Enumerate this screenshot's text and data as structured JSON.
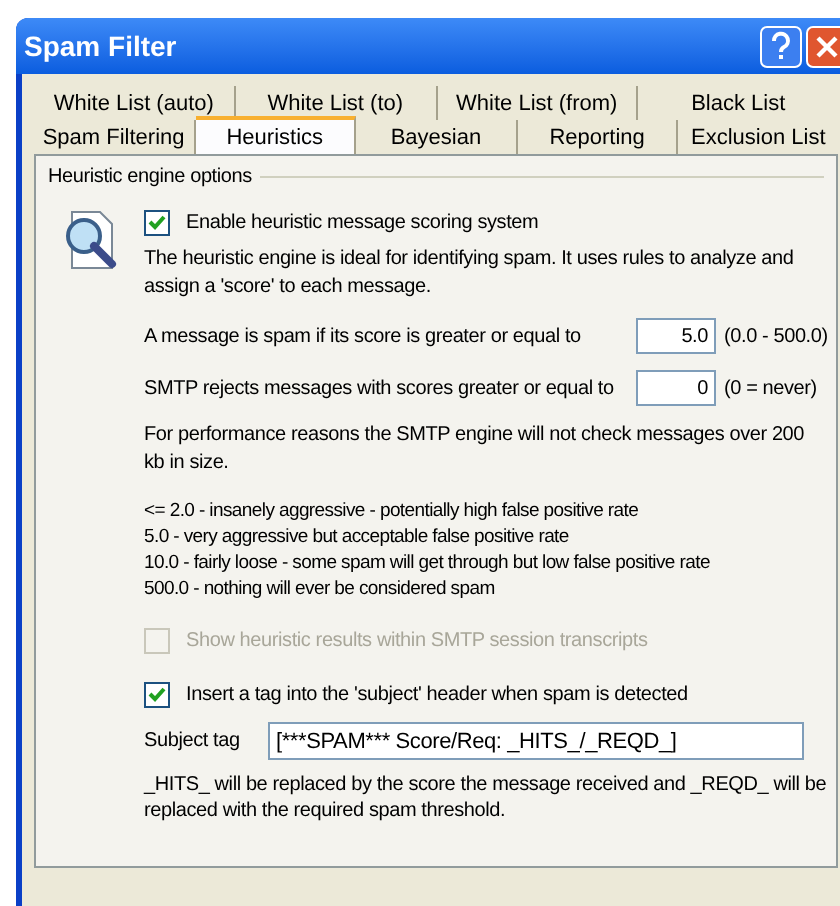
{
  "window": {
    "title": "Spam Filter"
  },
  "tab_rows": [
    [
      {
        "label": "White List (auto)",
        "selected": false
      },
      {
        "label": "White List (to)",
        "selected": false
      },
      {
        "label": "White List (from)",
        "selected": false
      },
      {
        "label": "Black List",
        "selected": false
      }
    ],
    [
      {
        "label": "Spam Filtering",
        "selected": false
      },
      {
        "label": "Heuristics",
        "selected": true
      },
      {
        "label": "Bayesian",
        "selected": false
      },
      {
        "label": "Reporting",
        "selected": false
      },
      {
        "label": "Exclusion List",
        "selected": false
      }
    ]
  ],
  "group": {
    "title": "Heuristic engine options",
    "enable": {
      "label": "Enable heuristic message scoring system",
      "checked": true
    },
    "intro": "The heuristic engine is ideal for identifying spam.  It uses rules to analyze and assign a 'score' to each message.",
    "fields": [
      {
        "label": "A message is spam if its score is greater or equal to",
        "value": "5.0",
        "hint": "(0.0 - 500.0)"
      },
      {
        "label": "SMTP rejects messages with scores greater or equal to",
        "value": "0",
        "hint": "(0 = never)"
      }
    ],
    "performance_note": "For performance reasons the SMTP engine will not check messages over 200 kb in size.",
    "scale": [
      "<= 2.0 - insanely aggressive - potentially high false positive rate",
      "5.0 - very aggressive but acceptable false positive rate",
      "10.0 - fairly loose - some spam will get through but low false positive rate",
      "500.0 - nothing will ever be considered spam"
    ],
    "show_results": {
      "label": "Show heuristic results within SMTP session transcripts",
      "checked": false,
      "disabled": true
    },
    "insert_tag": {
      "label": "Insert a tag into the 'subject' header when spam is detected",
      "checked": true
    },
    "subject_tag": {
      "label": "Subject tag",
      "value": "[***SPAM*** Score/Req: _HITS_/_REQD_]"
    },
    "tag_note": "_HITS_ will be replaced by the score the message received and _REQD_ will be replaced with the required spam threshold."
  }
}
